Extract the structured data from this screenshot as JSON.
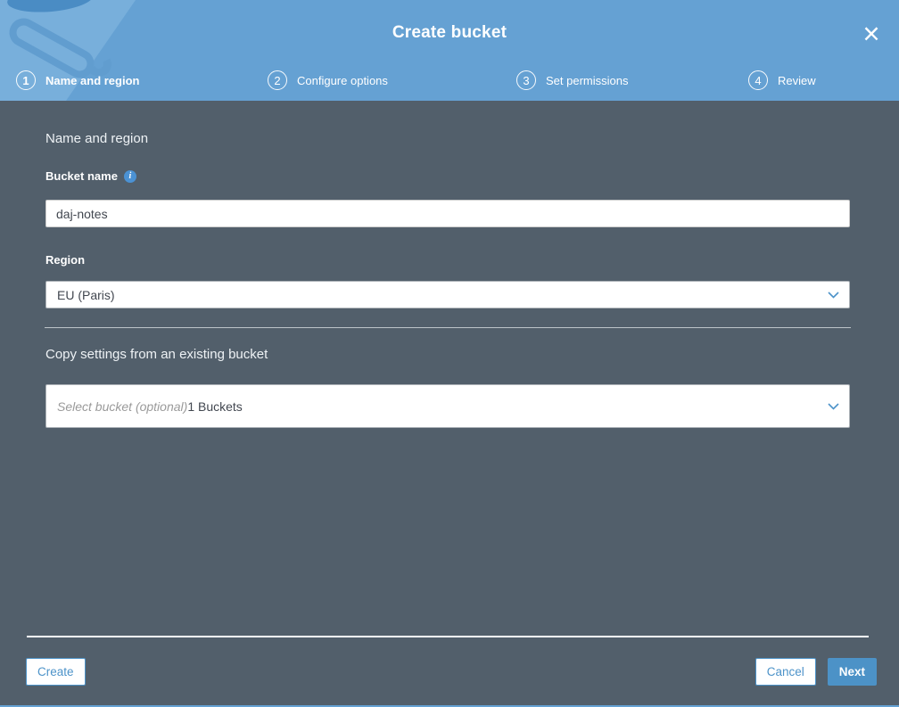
{
  "header": {
    "title": "Create bucket",
    "close_glyph": "×"
  },
  "steps": [
    {
      "number": "1",
      "label": "Name and region"
    },
    {
      "number": "2",
      "label": "Configure options"
    },
    {
      "number": "3",
      "label": "Set permissions"
    },
    {
      "number": "4",
      "label": "Review"
    }
  ],
  "form": {
    "section_heading": "Name and region",
    "bucket_name": {
      "label": "Bucket name",
      "info_glyph": "i",
      "value": "daj-notes"
    },
    "region": {
      "label": "Region",
      "value": "EU (Paris)"
    },
    "copy_settings": {
      "heading": "Copy settings from an existing bucket",
      "placeholder": "Select bucket (optional)",
      "suffix": "1 Buckets"
    }
  },
  "footer": {
    "create_label": "Create",
    "cancel_label": "Cancel",
    "next_label": "Next"
  },
  "icons": {
    "info": "blue circle with italic i",
    "close": "thin white x",
    "chevron_down": "blue chevron"
  },
  "colors": {
    "header_blue": "#65a1d3",
    "body_slate": "#525f6b",
    "accent_blue": "#4d93c9",
    "watermark_light": "#78afdb",
    "watermark_dark": "#4a8cc4",
    "input_text": "#424750"
  }
}
